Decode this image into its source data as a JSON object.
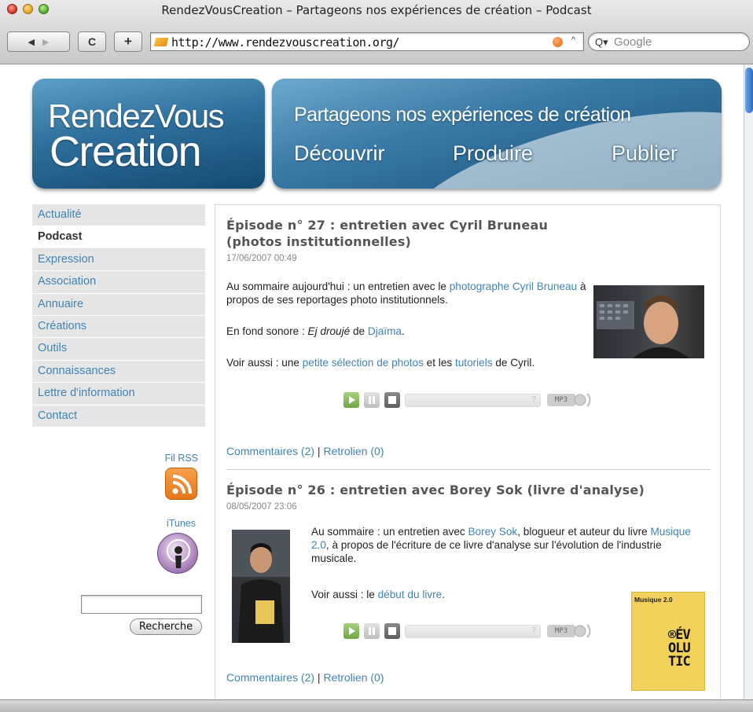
{
  "browser": {
    "window_title": "RendezVousCreation – Partageons nos expériences de création – Podcast",
    "url": "http://www.rendezvouscreation.org/",
    "search_placeholder": "Google",
    "back_glyph": "◀",
    "forward_glyph": "▶",
    "reload_glyph": "C",
    "add_glyph": "+"
  },
  "header": {
    "logo_line1": "RendezVous",
    "logo_line2": "Creation",
    "tagline": "Partageons nos expériences de création",
    "words": [
      "Découvrir",
      "Produire",
      "Publier"
    ]
  },
  "nav": {
    "items": [
      {
        "label": "Actualité",
        "active": false
      },
      {
        "label": "Podcast",
        "active": true
      },
      {
        "label": "Expression",
        "active": false
      },
      {
        "label": "Association",
        "active": false
      },
      {
        "label": "Annuaire",
        "active": false
      },
      {
        "label": "Créations",
        "active": false
      },
      {
        "label": "Outils",
        "active": false
      },
      {
        "label": "Connaissances",
        "active": false
      },
      {
        "label": "Lettre d'information",
        "active": false
      },
      {
        "label": "Contact",
        "active": false
      }
    ]
  },
  "sidebar": {
    "rss_label": "Fil RSS",
    "itunes_label": "iTunes",
    "search_value": "",
    "search_button": "Recherche"
  },
  "episodes": [
    {
      "title": "Épisode n° 27 : entretien avec Cyril Bruneau (photos institutionnelles)",
      "date": "17/06/2007 00:49",
      "summary_prefix": "Au sommaire aujourd'hui : un entretien avec le ",
      "summary_link": "photographe Cyril Bruneau",
      "summary_suffix": " à propos de ses reportages photo institutionnels.",
      "bg_prefix": "En fond sonore : ",
      "bg_title": "Ej droujé",
      "bg_mid": " de ",
      "bg_link": "Djaïma",
      "bg_suffix": ".",
      "see_prefix": "Voir aussi : une ",
      "see_link1": "petite sélection de photos",
      "see_mid": " et les ",
      "see_link2": "tutoriels",
      "see_suffix": " de Cyril.",
      "comments": "Commentaires (2)",
      "sep": " | ",
      "trackbacks": "Retrolien (0)"
    },
    {
      "title": "Épisode n° 26 : entretien avec Borey Sok (livre d'analyse)",
      "date": "08/05/2007 23:06",
      "summary_prefix": "Au sommaire : un entretien avec ",
      "summary_link1": "Borey Sok",
      "summary_mid": ", blogueur et auteur du livre ",
      "summary_link2": "Musique 2.0",
      "summary_suffix": ", à propos de l'écriture de ce livre d'analyse sur l'évolution de l'industrie musicale.",
      "see_prefix": "Voir aussi : le ",
      "see_link": "début du livre",
      "see_suffix": ".",
      "book_title": "Musique 2.0",
      "book_cover_text": "®ÉV\nOLU\nTIC",
      "comments": "Commentaires (2)",
      "sep": " | ",
      "trackbacks": "Retrolien (0)"
    }
  ],
  "player": {
    "mp3_label": "MP3",
    "unknown_time": "?"
  },
  "colors": {
    "link": "#3f83b5",
    "nav_bg": "#e6e6e6",
    "brand_blue": "#2f6f9c",
    "play_green": "#7fb350",
    "rss_orange": "#e5761a"
  }
}
